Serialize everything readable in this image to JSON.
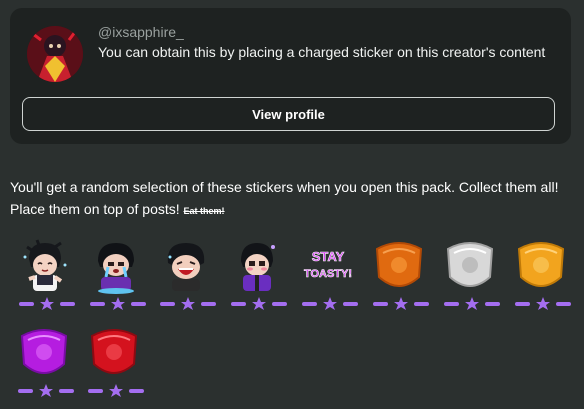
{
  "creator": {
    "handle": "@ixsapphire_",
    "message": "You can obtain this by placing a charged sticker on this creator's content",
    "view_profile_label": "View profile"
  },
  "pack": {
    "description": "You'll get a random selection of these stickers when you open this pack. Collect them all! Place them on top of posts!",
    "strikethrough_note": "Eat them!"
  },
  "stickers": [
    {
      "name": "chibi-dark-hair-eyes-closed",
      "rarity_stars": 1
    },
    {
      "name": "chibi-crying-purple",
      "rarity_stars": 1
    },
    {
      "name": "chibi-laughing",
      "rarity_stars": 1
    },
    {
      "name": "chibi-purple-outfit-blush",
      "rarity_stars": 1
    },
    {
      "name": "stay-toasty-text",
      "text": "STAY TOASTY!",
      "rarity_stars": 1
    },
    {
      "name": "badge-bronze",
      "color": "#e06a10",
      "rarity_stars": 1
    },
    {
      "name": "badge-silver",
      "color": "#d8d8d8",
      "rarity_stars": 1
    },
    {
      "name": "badge-gold",
      "color": "#f2a41e",
      "rarity_stars": 1
    },
    {
      "name": "badge-purple",
      "color": "#b51de0",
      "rarity_stars": 1
    },
    {
      "name": "badge-red",
      "color": "#d4121e",
      "rarity_stars": 1
    }
  ],
  "colors": {
    "rarity": "#a46ef0",
    "card_bg": "#1e2221",
    "page_bg": "#2b302f"
  }
}
